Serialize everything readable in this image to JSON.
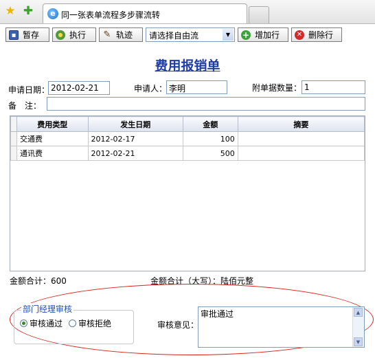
{
  "browser": {
    "tab_title": "同一张表单流程多步骤流转",
    "favorites_icon": "star-icon",
    "add_favorites_icon": "add-favorite-icon"
  },
  "toolbar": {
    "save_label": "暂存",
    "execute_label": "执行",
    "trace_label": "轨迹",
    "flow_select_value": "请选择自由流",
    "add_row_label": "增加行",
    "delete_row_label": "删除行"
  },
  "form": {
    "title": "费用报销单",
    "apply_date_label": "申请日期：",
    "apply_date_value": "2012-02-21",
    "applicant_label": "申请人：",
    "applicant_value": "李明",
    "attachments_label": "附单据数量：",
    "attachments_value": "1",
    "remark_label": "备　注：",
    "remark_value": ""
  },
  "grid": {
    "columns": [
      "费用类型",
      "发生日期",
      "金额",
      "摘要"
    ],
    "rows": [
      {
        "type": "交通费",
        "date": "2012-02-17",
        "amount": "100",
        "summary": ""
      },
      {
        "type": "通讯费",
        "date": "2012-02-21",
        "amount": "500",
        "summary": ""
      }
    ]
  },
  "totals": {
    "sum_label": "金额合计：600",
    "sum_upper_label": "金额合计（大写）：陆佰元整"
  },
  "approval": {
    "section_title": "部门经理审核",
    "approve_label": "审核通过",
    "reject_label": "审核拒绝",
    "selected": "approve",
    "opinion_label": "审核意见：",
    "opinion_value": "审批通过"
  },
  "colors": {
    "title": "#1f3ca6",
    "annotation_ellipse": "#d8231a"
  }
}
